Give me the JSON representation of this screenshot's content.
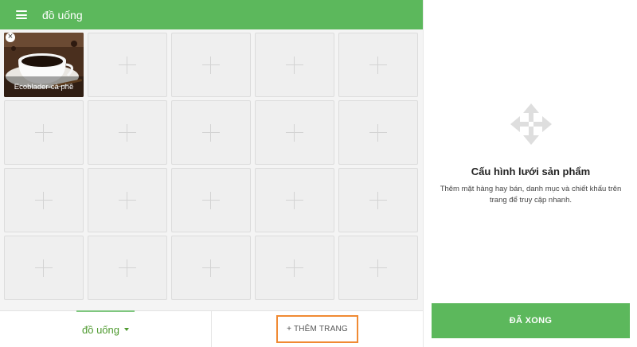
{
  "header": {
    "title": "đồ uống",
    "menu_icon": "hamburger-menu-icon"
  },
  "grid": {
    "product": {
      "label": "Ecoblader-cà phê",
      "remove_icon": "close-icon",
      "remove_glyph": "×"
    },
    "empty_tile_icon": "plus-icon"
  },
  "bottom": {
    "category_tab": "đồ uống",
    "add_page": "+ THÊM TRANG"
  },
  "side_panel": {
    "icon": "move-arrows-icon",
    "title": "Cấu hình lưới sản phẩm",
    "description": "Thêm mặt hàng hay bán, danh mục và chiết khấu trên trang để truy cập nhanh.",
    "done_button": "ĐÃ XONG"
  },
  "colors": {
    "brand_green": "#5cb85c",
    "highlight_orange": "#f08a33"
  }
}
